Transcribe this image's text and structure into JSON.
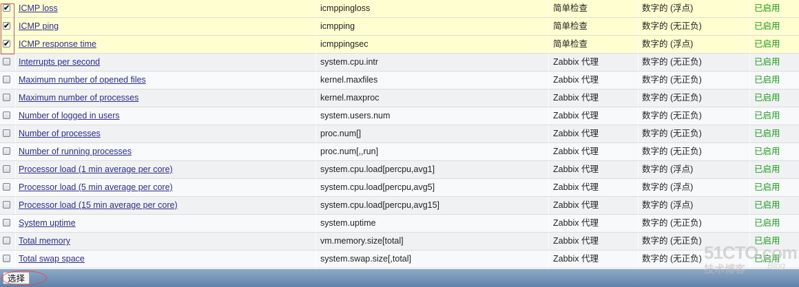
{
  "items": [
    {
      "name": "ICMP loss",
      "key": "icmppingloss",
      "type": "简单检查",
      "info": "数字的 (浮点)",
      "status": "已启用",
      "checked": true
    },
    {
      "name": "ICMP ping",
      "key": "icmpping",
      "type": "简单检查",
      "info": "数字的 (无正负)",
      "status": "已启用",
      "checked": true
    },
    {
      "name": "ICMP response time",
      "key": "icmppingsec",
      "type": "简单检查",
      "info": "数字的 (浮点)",
      "status": "已启用",
      "checked": true
    },
    {
      "name": "Interrupts per second",
      "key": "system.cpu.intr",
      "type": "Zabbix 代理",
      "info": "数字的 (无正负)",
      "status": "已启用",
      "checked": false
    },
    {
      "name": "Maximum number of opened files",
      "key": "kernel.maxfiles",
      "type": "Zabbix 代理",
      "info": "数字的 (无正负)",
      "status": "已启用",
      "checked": false
    },
    {
      "name": "Maximum number of processes",
      "key": "kernel.maxproc",
      "type": "Zabbix 代理",
      "info": "数字的 (无正负)",
      "status": "已启用",
      "checked": false
    },
    {
      "name": "Number of logged in users",
      "key": "system.users.num",
      "type": "Zabbix 代理",
      "info": "数字的 (无正负)",
      "status": "已启用",
      "checked": false
    },
    {
      "name": "Number of processes",
      "key": "proc.num[]",
      "type": "Zabbix 代理",
      "info": "数字的 (无正负)",
      "status": "已启用",
      "checked": false
    },
    {
      "name": "Number of running processes",
      "key": "proc.num[,,run]",
      "type": "Zabbix 代理",
      "info": "数字的 (无正负)",
      "status": "已启用",
      "checked": false
    },
    {
      "name": "Processor load (1 min average per core)",
      "key": "system.cpu.load[percpu,avg1]",
      "type": "Zabbix 代理",
      "info": "数字的 (浮点)",
      "status": "已启用",
      "checked": false
    },
    {
      "name": "Processor load (5 min average per core)",
      "key": "system.cpu.load[percpu,avg5]",
      "type": "Zabbix 代理",
      "info": "数字的 (浮点)",
      "status": "已启用",
      "checked": false
    },
    {
      "name": "Processor load (15 min average per core)",
      "key": "system.cpu.load[percpu,avg15]",
      "type": "Zabbix 代理",
      "info": "数字的 (浮点)",
      "status": "已启用",
      "checked": false
    },
    {
      "name": "System uptime",
      "key": "system.uptime",
      "type": "Zabbix 代理",
      "info": "数字的 (无正负)",
      "status": "已启用",
      "checked": false
    },
    {
      "name": "Total memory",
      "key": "vm.memory.size[total]",
      "type": "Zabbix 代理",
      "info": "数字的 (无正负)",
      "status": "已启用",
      "checked": false
    },
    {
      "name": "Total swap space",
      "key": "system.swap.size[,total]",
      "type": "Zabbix 代理",
      "info": "数字的 (无正负)",
      "status": "已启用",
      "checked": false
    }
  ],
  "footer": {
    "select_label": "选择"
  },
  "watermark": {
    "site": "51CTO.com",
    "tagline": "技术博客",
    "blog": "Blog"
  },
  "colors": {
    "selected_row": "#fefed1",
    "status_enabled": "#1c9e1c",
    "link": "#2d2d8f",
    "footer": "#6f8fb5"
  }
}
